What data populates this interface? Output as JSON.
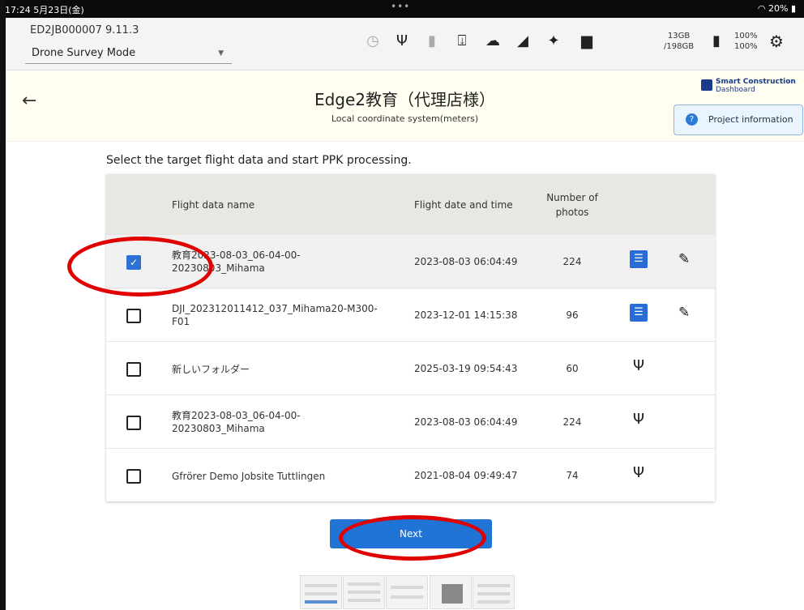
{
  "statusbar": {
    "time": "17:24  5月23日(金)",
    "battery": "20%"
  },
  "header": {
    "device": "ED2JB000007   9.11.3",
    "mode": "Drone Survey Mode",
    "storage_used": "13GB",
    "storage_total": "/198GB",
    "pct1": "100%",
    "pct2": "100%"
  },
  "titlebar": {
    "title": "Edge2教育（代理店様）",
    "subtitle": "Local coordinate system(meters)",
    "logo_line1": "Smart Construction",
    "logo_line2": "Dashboard",
    "project_info": "Project information"
  },
  "instruction": "Select the target flight data and start PPK processing.",
  "table": {
    "headers": {
      "name": "Flight data name",
      "date": "Flight date and time",
      "photos_line1": "Number of",
      "photos_line2": "photos"
    },
    "rows": [
      {
        "name_line1": "教育2023-08-03_06-04-00-",
        "name_line2": "20230803_Mihama",
        "date": "2023-08-03 06:04:49",
        "photos": "224",
        "checked": true,
        "source": "database-icon",
        "editable": true
      },
      {
        "name_line1": "DJI_202312011412_037_Mihama20-M300-",
        "name_line2": "F01",
        "date": "2023-12-01 14:15:38",
        "photos": "96",
        "checked": false,
        "source": "database-icon",
        "editable": true
      },
      {
        "name_line1": "新しいフォルダー",
        "name_line2": "",
        "date": "2025-03-19 09:54:43",
        "photos": "60",
        "checked": false,
        "source": "usb-icon",
        "editable": false
      },
      {
        "name_line1": "教育2023-08-03_06-04-00-",
        "name_line2": "20230803_Mihama",
        "date": "2023-08-03 06:04:49",
        "photos": "224",
        "checked": false,
        "source": "usb-icon",
        "editable": false
      },
      {
        "name_line1": "Gfrörer Demo Jobsite Tuttlingen",
        "name_line2": "",
        "date": "2021-08-04 09:49:47",
        "photos": "74",
        "checked": false,
        "source": "usb-icon",
        "editable": false
      }
    ]
  },
  "next_label": "Next",
  "colors": {
    "accent": "#1f74d6",
    "annotation": "#e00000",
    "header_row": "#e9e7e1"
  }
}
